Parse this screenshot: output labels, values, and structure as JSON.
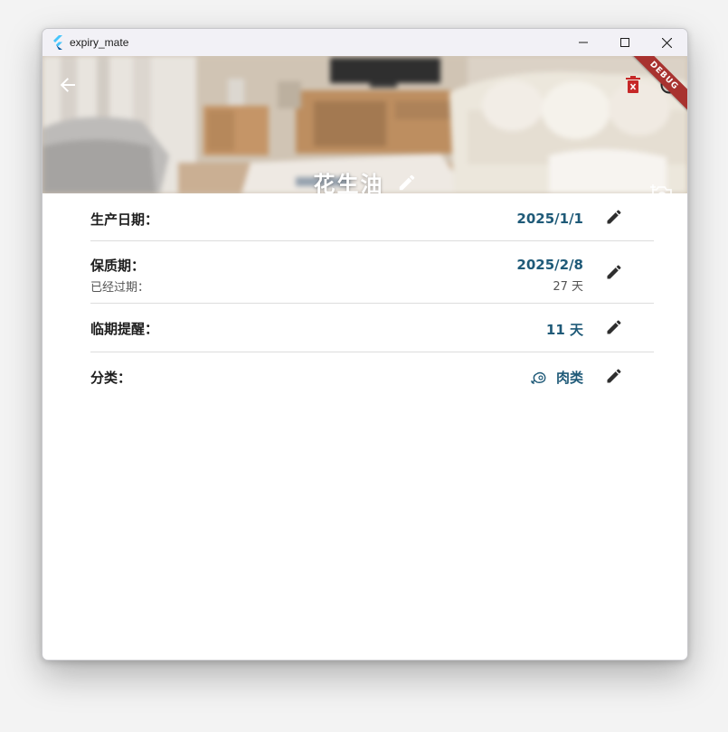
{
  "window": {
    "title": "expiry_mate"
  },
  "header": {
    "item_name": "花生油",
    "debug_banner": "DEBUG"
  },
  "fields": {
    "production_date": {
      "label": "生产日期：",
      "value": "2025/1/1"
    },
    "shelf_life": {
      "label": "保质期：",
      "value": "2025/2/8",
      "sub_label": "已经过期：",
      "sub_value": "27 天"
    },
    "reminder": {
      "label": "临期提醒：",
      "value": "11 天"
    },
    "category": {
      "label": "分类：",
      "value": "肉类",
      "icon": "meat-icon"
    }
  },
  "colors": {
    "accent": "#1f5a78",
    "danger": "#c62828",
    "debug_ribbon": "#a8322f"
  }
}
